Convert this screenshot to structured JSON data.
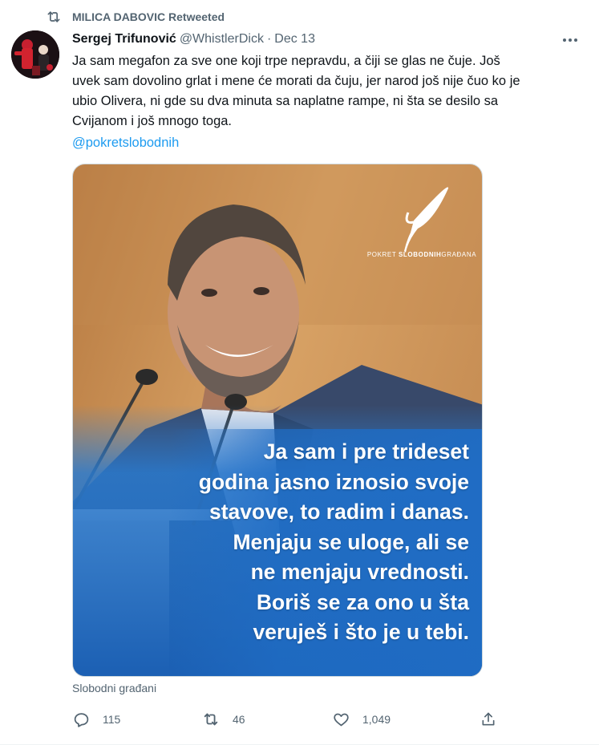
{
  "retweet_header": {
    "text": "MILICA DABOVIC Retweeted",
    "icon": "retweet-icon"
  },
  "author": {
    "name": "Sergej Trifunović",
    "handle": "@WhistlerDick",
    "separator": "·",
    "date": "Dec 13"
  },
  "tweet": {
    "lines": [
      "Ja sam megafon za sve one koji trpe nepravdu, a čiji se glas ne čuje. Još",
      "uvek sam dovolino grlat i mene će morati da čuju, jer narod još nije čuo ko je",
      "ubio Olivera, ni gde su dva minuta sa naplatne rampe, ni šta se desilo sa",
      "Cvijanom i još mnogo toga."
    ],
    "mention": "@pokretslobodnih"
  },
  "media": {
    "logo": {
      "prefix": "POKRET ",
      "bold": "SLOBODNIH",
      "suffix": "GRAĐANA"
    },
    "quote_lines": [
      "Ja sam i pre trideset",
      "godina jasno iznosio svoje",
      "stavove, to radim i danas.",
      "Menjaju se uloge, ali se",
      "ne menjaju vrednosti.",
      "Boriš se za ono u šta",
      "veruješ i što je u tebi."
    ]
  },
  "source_label": "Slobodni građani",
  "actions": {
    "reply": {
      "icon": "reply-icon",
      "count": "115"
    },
    "retweet": {
      "icon": "retweet-icon",
      "count": "46"
    },
    "like": {
      "icon": "heart-icon",
      "count": "1,049"
    },
    "share": {
      "icon": "share-icon"
    }
  },
  "colors": {
    "text": "#0f1419",
    "secondary": "#536471",
    "link": "#1d9bf0",
    "quote_blue": "#1f74c9"
  }
}
